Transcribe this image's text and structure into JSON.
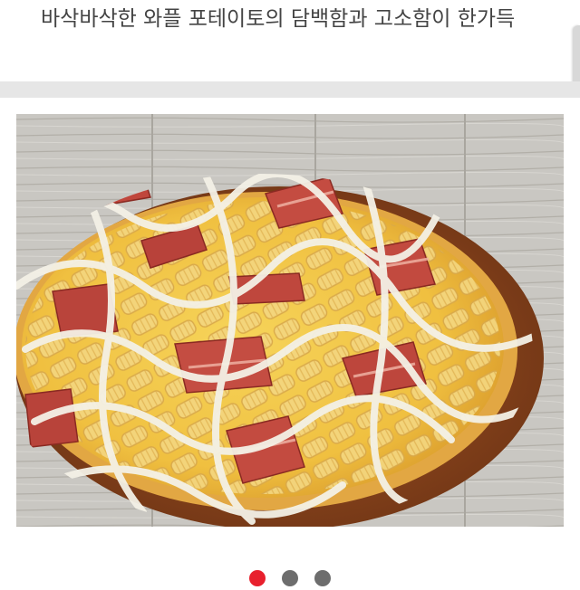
{
  "product": {
    "description": "바삭바삭한 와플 포테이토의 담백함과 고소함이 한가득",
    "image_alt": "Pizza with waffle fries, bacon and ranch sauce on a wooden board"
  },
  "pager": {
    "total": 3,
    "active_index": 0
  },
  "colors": {
    "accent": "#e8202d",
    "dot_inactive": "#6d6d6d",
    "divider": "#e6e6e6",
    "text": "#444444"
  }
}
